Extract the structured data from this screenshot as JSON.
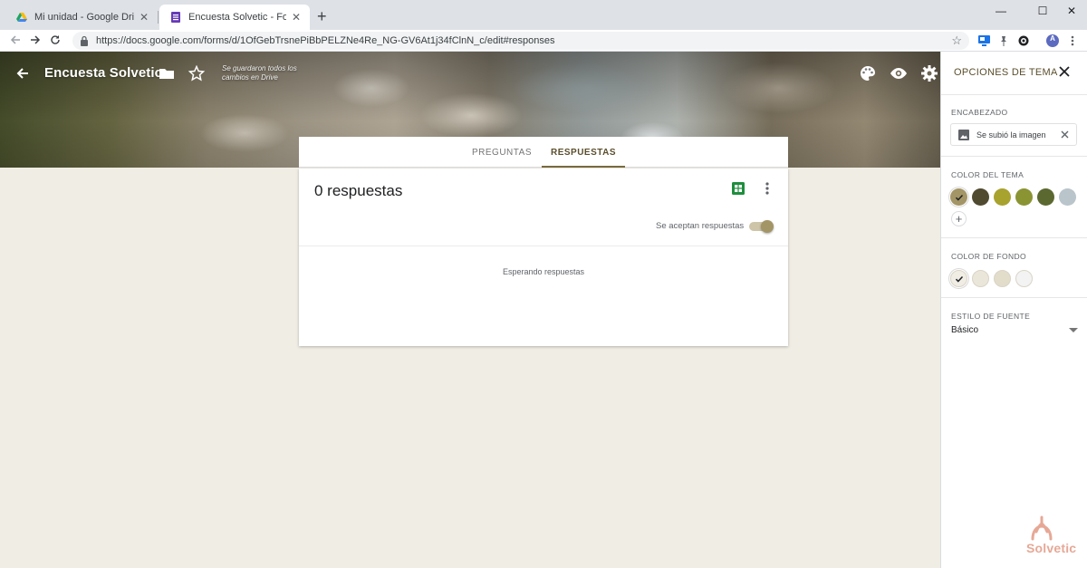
{
  "browser": {
    "tabs": [
      {
        "title": "Mi unidad - Google Drive",
        "icon": "google-drive-icon"
      },
      {
        "title": "Encuesta Solvetic - Formularios d",
        "icon": "google-forms-icon",
        "active": true
      }
    ],
    "url": "https://docs.google.com/forms/d/1OfGebTrsnePiBbPELZNe4Re_NG-GV6At1j34fClnN_c/edit#responses",
    "profile_initial": "A"
  },
  "header": {
    "title": "Encuesta Solvetic",
    "save_status": "Se guardaron todos los cambios en Drive"
  },
  "form_tabs": {
    "questions": "PREGUNTAS",
    "responses": "RESPUESTAS",
    "active": "responses"
  },
  "responses": {
    "count_label": "0 respuestas",
    "accepting_label": "Se aceptan respuestas",
    "accepting": true,
    "waiting_label": "Esperando respuestas"
  },
  "theme_panel": {
    "title": "OPCIONES DE TEMA",
    "header_section": "ENCABEZADO",
    "header_value": "Se subió la imagen",
    "theme_color_section": "COLOR DEL TEMA",
    "theme_colors": [
      "#a39566",
      "#4f4a30",
      "#a8a22f",
      "#8a9433",
      "#5b6830",
      "#b9c5cb"
    ],
    "theme_color_selected": 0,
    "bg_color_section": "COLOR DE FONDO",
    "bg_colors": [
      "#f0ede5",
      "#ebe6da",
      "#e2dcca",
      "#f3f3f3"
    ],
    "bg_color_selected": 0,
    "font_section": "ESTILO DE FUENTE",
    "font_value": "Básico"
  },
  "watermark": {
    "text": "Solvetic",
    "color": "#e6a896"
  }
}
